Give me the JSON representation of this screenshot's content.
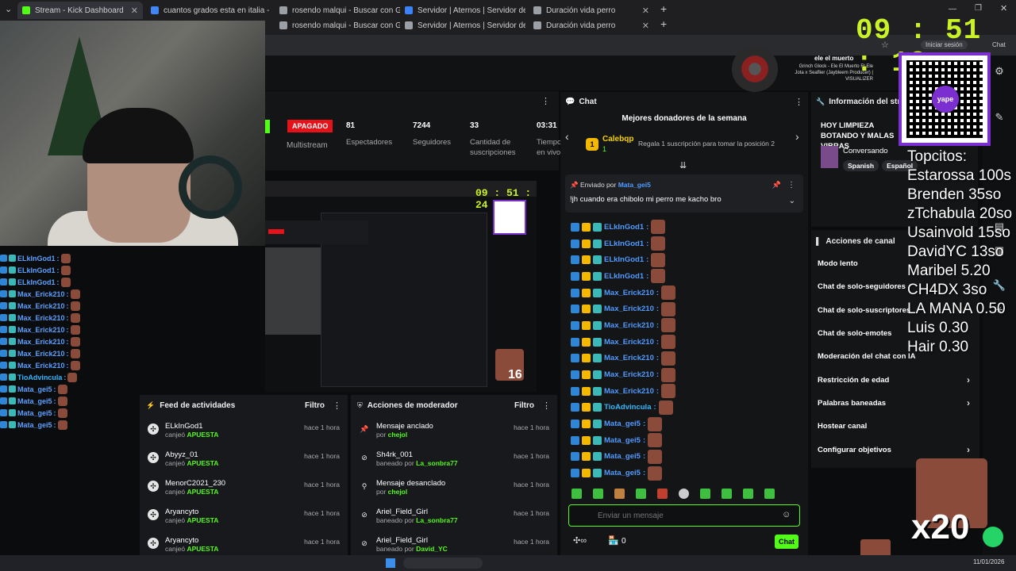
{
  "browser": {
    "tabs_row1": [
      {
        "label": "Stream - Kick Dashboard",
        "color": "#53fc18"
      },
      {
        "label": "cuantos grados esta en italia - Bus",
        "color": "#4285f4"
      },
      {
        "label": "rosendo malqui - Buscar con Goog",
        "color": "#9aa0a6"
      },
      {
        "label": "Servidor | Aternos | Servidor de M",
        "color": "#3b82f6"
      },
      {
        "label": "Duración vida perro",
        "color": "#9aa0a6"
      }
    ],
    "tabs_row2": [
      {
        "label": "rosendo malqui - Buscar con Goog"
      },
      {
        "label": "Servidor | Aternos | Servidor de M"
      },
      {
        "label": "Duración vida perro"
      }
    ],
    "signin": "Iniciar sesión",
    "chat_btn": "Chat"
  },
  "overlay": {
    "timer": "09 : 51 : 19",
    "song_title": "ele el muerto",
    "song_sub": "Grinch Glock - Ele El Muerto Ft Ele Jota x Seaflier (Jaybleem Producer) | VISUALIZER",
    "qr_label": "yape",
    "topcitos_title": "Topcitos:",
    "topcitos": [
      "Estarossa 100s",
      "Brenden 35so",
      "zTchabula 20so",
      "Usainvold 15so",
      "DavidYC 13so",
      "Maribel 5.20",
      "CH4DX 3so",
      "LA MANA 0.50",
      "Luis 0.30",
      "Hair 0.30"
    ],
    "multiplier": "x20"
  },
  "stats": {
    "status": "APAGADO",
    "multistream": "Multistream",
    "items": [
      {
        "value": "81",
        "label": "Espectadores"
      },
      {
        "value": "7244",
        "label": "Seguidores"
      },
      {
        "value": "33",
        "label": "Cantidad de suscripciones"
      },
      {
        "value": "03:31",
        "label": "Tiempo en vivo"
      }
    ]
  },
  "preview": {
    "timer": "09 : 51 : 24",
    "badge": "16"
  },
  "left_chat": [
    {
      "name": "ELkInGod1",
      "color": "#5aa0ff"
    },
    {
      "name": "ELkInGod1",
      "color": "#5aa0ff"
    },
    {
      "name": "ELkInGod1",
      "color": "#5aa0ff"
    },
    {
      "name": "Max_Erick210",
      "color": "#5aa0ff"
    },
    {
      "name": "Max_Erick210",
      "color": "#5aa0ff"
    },
    {
      "name": "Max_Erick210",
      "color": "#5aa0ff"
    },
    {
      "name": "Max_Erick210",
      "color": "#5aa0ff"
    },
    {
      "name": "Max_Erick210",
      "color": "#5aa0ff"
    },
    {
      "name": "Max_Erick210",
      "color": "#5aa0ff"
    },
    {
      "name": "Max_Erick210",
      "color": "#5aa0ff"
    },
    {
      "name": "TioAdvincula",
      "color": "#2fb7ff"
    },
    {
      "name": "Mata_gei5",
      "color": "#5aa0ff"
    },
    {
      "name": "Mata_gei5",
      "color": "#5aa0ff"
    },
    {
      "name": "Mata_gei5",
      "color": "#5aa0ff"
    },
    {
      "name": "Mata_gei5",
      "color": "#5aa0ff"
    }
  ],
  "feed": {
    "title": "Feed de actividades",
    "filter": "Filtro",
    "items": [
      {
        "user": "ELkInGod1",
        "action": "canjeó",
        "reward": "APUESTA",
        "time": "hace 1 hora"
      },
      {
        "user": "Abyyz_01",
        "action": "canjeó",
        "reward": "APUESTA",
        "time": "hace 1 hora"
      },
      {
        "user": "MenorC2021_230",
        "action": "canjeó",
        "reward": "APUESTA",
        "time": "hace 1 hora"
      },
      {
        "user": "Aryancyto",
        "action": "canjeó",
        "reward": "APUESTA",
        "time": "hace 1 hora"
      },
      {
        "user": "Aryancyto",
        "action": "canjeó",
        "reward": "APUESTA",
        "time": "hace 1 hora"
      }
    ]
  },
  "mod_actions": {
    "title": "Acciones de moderador",
    "filter": "Filtro",
    "items": [
      {
        "title": "Mensaje anclado",
        "by_label": "por",
        "by": "chejol",
        "time": "hace 1 hora",
        "icon": "pin-icon"
      },
      {
        "title": "Sh4rk_001",
        "by_label": "baneado por",
        "by": "La_sonbra77",
        "time": "hace 1 hora",
        "icon": "ban-icon"
      },
      {
        "title": "Mensaje desanclado",
        "by_label": "por",
        "by": "chejol",
        "time": "hace 1 hora",
        "icon": "unpin-icon"
      },
      {
        "title": "Ariel_Field_Girl",
        "by_label": "baneado por",
        "by": "La_sonbra77",
        "time": "hace 1 hora",
        "icon": "ban-icon"
      },
      {
        "title": "Ariel_Field_Girl",
        "by_label": "baneado por",
        "by": "David_YC",
        "time": "hace 1 hora",
        "icon": "ban-icon"
      }
    ]
  },
  "chat": {
    "title": "Chat",
    "donors_title": "Mejores donadores de la semana",
    "top_donor": "Calebqp",
    "top_rank": "1",
    "top_count": "1",
    "gift_prompt": "Regala 1 suscripción para tomar la posición 2",
    "pinned_label": "Enviado por",
    "pinned_user": "Mata_gei5",
    "pinned_msg": "!jh cuando era chibolo mi perro me kacho bro",
    "messages": [
      {
        "name": "ELkInGod1",
        "color": "#4f9bff"
      },
      {
        "name": "ELkInGod1",
        "color": "#4f9bff"
      },
      {
        "name": "ELkInGod1",
        "color": "#4f9bff"
      },
      {
        "name": "ELkInGod1",
        "color": "#4f9bff"
      },
      {
        "name": "Max_Erick210",
        "color": "#4f9bff"
      },
      {
        "name": "Max_Erick210",
        "color": "#4f9bff"
      },
      {
        "name": "Max_Erick210",
        "color": "#4f9bff"
      },
      {
        "name": "Max_Erick210",
        "color": "#4f9bff"
      },
      {
        "name": "Max_Erick210",
        "color": "#4f9bff"
      },
      {
        "name": "Max_Erick210",
        "color": "#4f9bff"
      },
      {
        "name": "Max_Erick210",
        "color": "#4f9bff"
      },
      {
        "name": "TioAdvincula",
        "color": "#2fb7ff"
      },
      {
        "name": "Mata_gei5",
        "color": "#4f9bff"
      },
      {
        "name": "Mata_gei5",
        "color": "#4f9bff"
      },
      {
        "name": "Mata_gei5",
        "color": "#4f9bff"
      },
      {
        "name": "Mata_gei5",
        "color": "#4f9bff"
      }
    ],
    "input_placeholder": "Enviar un mensaje",
    "points": "0",
    "send": "Chat"
  },
  "info": {
    "title": "Información del stream",
    "stream_title": "HOY LIMPIEZA BOTANDO Y MALAS VIBRAS",
    "category": "Conversando",
    "tags": [
      "Spanish",
      "Español"
    ]
  },
  "actions": {
    "title": "Acciones de canal",
    "items": [
      {
        "label": "Modo lento",
        "chev": false
      },
      {
        "label": "Chat de solo-seguidores",
        "chev": false
      },
      {
        "label": "Chat de solo-suscriptores",
        "chev": false
      },
      {
        "label": "Chat de solo-emotes",
        "chev": false
      },
      {
        "label": "Moderación del chat con IA",
        "chev": false
      },
      {
        "label": "Restricción de edad",
        "chev": true
      },
      {
        "label": "Palabras baneadas",
        "chev": true
      },
      {
        "label": "Hostear canal",
        "chev": false
      },
      {
        "label": "Configurar objetivos",
        "chev": true
      }
    ]
  },
  "taskbar": {
    "date": "11/01/2026"
  },
  "colors": {
    "kick_green": "#53fc18",
    "apagado_red": "#e5121a",
    "timer_yellow": "#c9f227"
  }
}
